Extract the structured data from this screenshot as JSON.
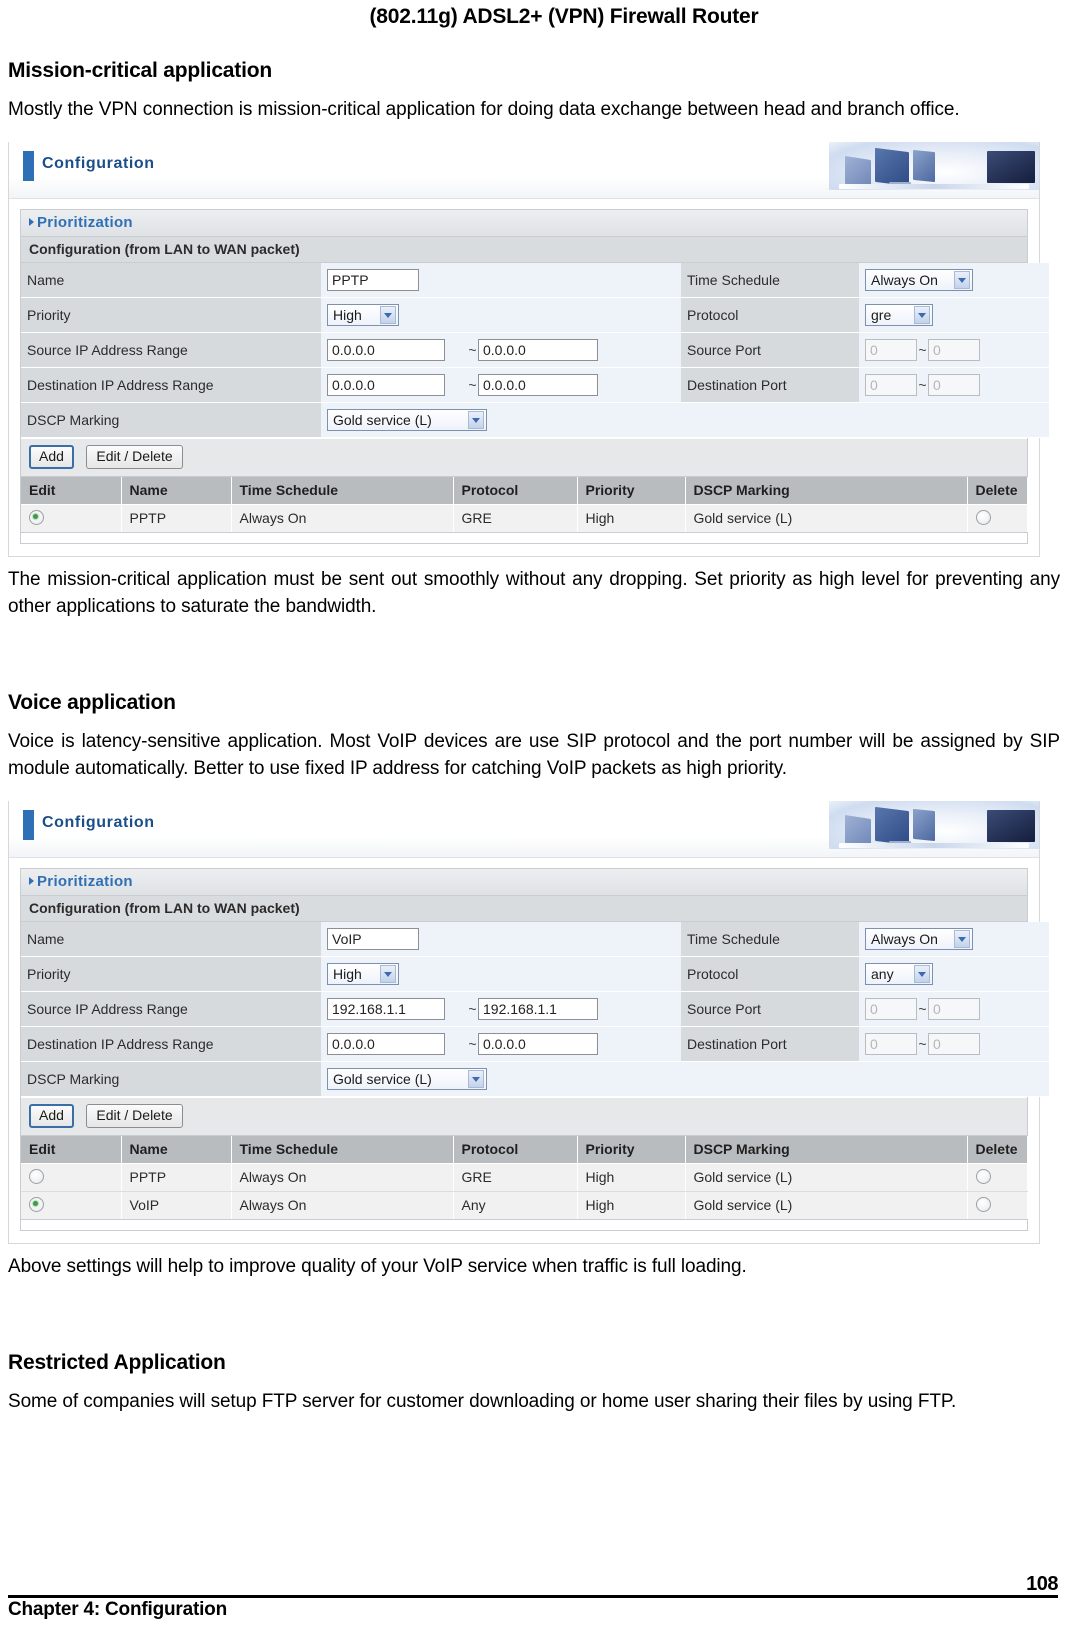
{
  "running_head": "(802.11g) ADSL2+ (VPN) Firewall Router",
  "sections": {
    "mission": {
      "heading": "Mission-critical application",
      "intro": "Mostly the VPN connection is mission-critical application for doing data exchange between head and branch office.",
      "outro_line1": "The mission-critical application must be sent out smoothly without any dropping. Set priority as high level for preventing any other applications to saturate the bandwidth."
    },
    "voice": {
      "heading": "Voice application",
      "intro": "Voice is latency-sensitive application. Most VoIP devices are use SIP protocol and the port number will be assigned by SIP module automatically. Better to use fixed IP address for catching VoIP packets as high priority.",
      "outro": "Above settings will help to improve quality of your VoIP service when traffic is full loading."
    },
    "restricted": {
      "heading": "Restricted Application",
      "intro": "Some of companies will setup FTP server for customer downloading or home user sharing their files by using FTP."
    }
  },
  "ui": {
    "window_title": "Configuration",
    "panel_title": "Prioritization",
    "subhead": "Configuration (from LAN to WAN packet)",
    "labels": {
      "name": "Name",
      "priority": "Priority",
      "source_ip_range": "Source IP Address Range",
      "destination_ip_range": "Destination IP Address Range",
      "dscp_marking": "DSCP Marking",
      "time_schedule": "Time Schedule",
      "protocol": "Protocol",
      "source_port": "Source Port",
      "destination_port": "Destination Port"
    },
    "buttons": {
      "add": "Add",
      "edit_delete": "Edit / Delete"
    },
    "table_headers": [
      "Edit",
      "Name",
      "Time Schedule",
      "Protocol",
      "Priority",
      "DSCP Marking",
      "Delete"
    ],
    "range_separator": "~"
  },
  "shot1": {
    "form": {
      "name": "PPTP",
      "priority": "High",
      "source_ip_from": "0.0.0.0",
      "source_ip_to": "0.0.0.0",
      "destination_ip_from": "0.0.0.0",
      "destination_ip_to": "0.0.0.0",
      "dscp_marking": "Gold service (L)",
      "time_schedule": "Always On",
      "protocol": "gre",
      "source_port_from": "0",
      "source_port_to": "0",
      "destination_port_from": "0",
      "destination_port_to": "0"
    },
    "rows": [
      {
        "edit_selected": true,
        "name": "PPTP",
        "time_schedule": "Always On",
        "protocol": "GRE",
        "priority": "High",
        "dscp_marking": "Gold service (L)",
        "delete_selected": false
      }
    ]
  },
  "shot2": {
    "form": {
      "name": "VoIP",
      "priority": "High",
      "source_ip_from": "192.168.1.1",
      "source_ip_to": "192.168.1.1",
      "destination_ip_from": "0.0.0.0",
      "destination_ip_to": "0.0.0.0",
      "dscp_marking": "Gold service (L)",
      "time_schedule": "Always On",
      "protocol": "any",
      "source_port_from": "0",
      "source_port_to": "0",
      "destination_port_from": "0",
      "destination_port_to": "0"
    },
    "rows": [
      {
        "edit_selected": false,
        "name": "PPTP",
        "time_schedule": "Always On",
        "protocol": "GRE",
        "priority": "High",
        "dscp_marking": "Gold service (L)",
        "delete_selected": false
      },
      {
        "edit_selected": true,
        "name": "VoIP",
        "time_schedule": "Always On",
        "protocol": "Any",
        "priority": "High",
        "dscp_marking": "Gold service (L)",
        "delete_selected": false
      }
    ]
  },
  "footer": {
    "chapter": "Chapter 4: Configuration",
    "page_number": "108"
  },
  "colors": {
    "accent_blue": "#2f6fb5",
    "label_bg": "#d7dadd",
    "field_bg": "#eef3fa",
    "table_header_bg": "#b9bcbf",
    "radio_on": "#3f9a4e"
  }
}
